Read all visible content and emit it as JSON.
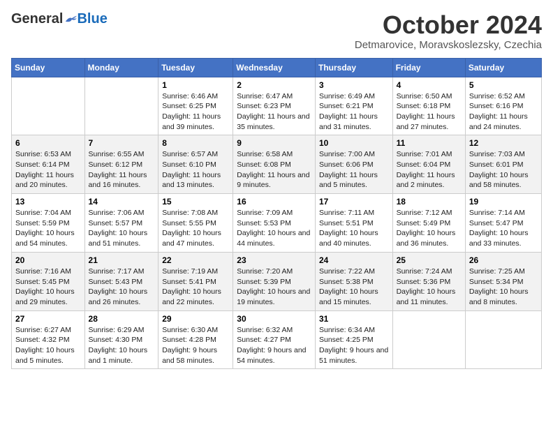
{
  "logo": {
    "general": "General",
    "blue": "Blue"
  },
  "title": "October 2024",
  "location": "Detmarovice, Moravskoslezsky, Czechia",
  "headers": [
    "Sunday",
    "Monday",
    "Tuesday",
    "Wednesday",
    "Thursday",
    "Friday",
    "Saturday"
  ],
  "weeks": [
    [
      {
        "day": "",
        "sunrise": "",
        "sunset": "",
        "daylight": ""
      },
      {
        "day": "",
        "sunrise": "",
        "sunset": "",
        "daylight": ""
      },
      {
        "day": "1",
        "sunrise": "Sunrise: 6:46 AM",
        "sunset": "Sunset: 6:25 PM",
        "daylight": "Daylight: 11 hours and 39 minutes."
      },
      {
        "day": "2",
        "sunrise": "Sunrise: 6:47 AM",
        "sunset": "Sunset: 6:23 PM",
        "daylight": "Daylight: 11 hours and 35 minutes."
      },
      {
        "day": "3",
        "sunrise": "Sunrise: 6:49 AM",
        "sunset": "Sunset: 6:21 PM",
        "daylight": "Daylight: 11 hours and 31 minutes."
      },
      {
        "day": "4",
        "sunrise": "Sunrise: 6:50 AM",
        "sunset": "Sunset: 6:18 PM",
        "daylight": "Daylight: 11 hours and 27 minutes."
      },
      {
        "day": "5",
        "sunrise": "Sunrise: 6:52 AM",
        "sunset": "Sunset: 6:16 PM",
        "daylight": "Daylight: 11 hours and 24 minutes."
      }
    ],
    [
      {
        "day": "6",
        "sunrise": "Sunrise: 6:53 AM",
        "sunset": "Sunset: 6:14 PM",
        "daylight": "Daylight: 11 hours and 20 minutes."
      },
      {
        "day": "7",
        "sunrise": "Sunrise: 6:55 AM",
        "sunset": "Sunset: 6:12 PM",
        "daylight": "Daylight: 11 hours and 16 minutes."
      },
      {
        "day": "8",
        "sunrise": "Sunrise: 6:57 AM",
        "sunset": "Sunset: 6:10 PM",
        "daylight": "Daylight: 11 hours and 13 minutes."
      },
      {
        "day": "9",
        "sunrise": "Sunrise: 6:58 AM",
        "sunset": "Sunset: 6:08 PM",
        "daylight": "Daylight: 11 hours and 9 minutes."
      },
      {
        "day": "10",
        "sunrise": "Sunrise: 7:00 AM",
        "sunset": "Sunset: 6:06 PM",
        "daylight": "Daylight: 11 hours and 5 minutes."
      },
      {
        "day": "11",
        "sunrise": "Sunrise: 7:01 AM",
        "sunset": "Sunset: 6:04 PM",
        "daylight": "Daylight: 11 hours and 2 minutes."
      },
      {
        "day": "12",
        "sunrise": "Sunrise: 7:03 AM",
        "sunset": "Sunset: 6:01 PM",
        "daylight": "Daylight: 10 hours and 58 minutes."
      }
    ],
    [
      {
        "day": "13",
        "sunrise": "Sunrise: 7:04 AM",
        "sunset": "Sunset: 5:59 PM",
        "daylight": "Daylight: 10 hours and 54 minutes."
      },
      {
        "day": "14",
        "sunrise": "Sunrise: 7:06 AM",
        "sunset": "Sunset: 5:57 PM",
        "daylight": "Daylight: 10 hours and 51 minutes."
      },
      {
        "day": "15",
        "sunrise": "Sunrise: 7:08 AM",
        "sunset": "Sunset: 5:55 PM",
        "daylight": "Daylight: 10 hours and 47 minutes."
      },
      {
        "day": "16",
        "sunrise": "Sunrise: 7:09 AM",
        "sunset": "Sunset: 5:53 PM",
        "daylight": "Daylight: 10 hours and 44 minutes."
      },
      {
        "day": "17",
        "sunrise": "Sunrise: 7:11 AM",
        "sunset": "Sunset: 5:51 PM",
        "daylight": "Daylight: 10 hours and 40 minutes."
      },
      {
        "day": "18",
        "sunrise": "Sunrise: 7:12 AM",
        "sunset": "Sunset: 5:49 PM",
        "daylight": "Daylight: 10 hours and 36 minutes."
      },
      {
        "day": "19",
        "sunrise": "Sunrise: 7:14 AM",
        "sunset": "Sunset: 5:47 PM",
        "daylight": "Daylight: 10 hours and 33 minutes."
      }
    ],
    [
      {
        "day": "20",
        "sunrise": "Sunrise: 7:16 AM",
        "sunset": "Sunset: 5:45 PM",
        "daylight": "Daylight: 10 hours and 29 minutes."
      },
      {
        "day": "21",
        "sunrise": "Sunrise: 7:17 AM",
        "sunset": "Sunset: 5:43 PM",
        "daylight": "Daylight: 10 hours and 26 minutes."
      },
      {
        "day": "22",
        "sunrise": "Sunrise: 7:19 AM",
        "sunset": "Sunset: 5:41 PM",
        "daylight": "Daylight: 10 hours and 22 minutes."
      },
      {
        "day": "23",
        "sunrise": "Sunrise: 7:20 AM",
        "sunset": "Sunset: 5:39 PM",
        "daylight": "Daylight: 10 hours and 19 minutes."
      },
      {
        "day": "24",
        "sunrise": "Sunrise: 7:22 AM",
        "sunset": "Sunset: 5:38 PM",
        "daylight": "Daylight: 10 hours and 15 minutes."
      },
      {
        "day": "25",
        "sunrise": "Sunrise: 7:24 AM",
        "sunset": "Sunset: 5:36 PM",
        "daylight": "Daylight: 10 hours and 11 minutes."
      },
      {
        "day": "26",
        "sunrise": "Sunrise: 7:25 AM",
        "sunset": "Sunset: 5:34 PM",
        "daylight": "Daylight: 10 hours and 8 minutes."
      }
    ],
    [
      {
        "day": "27",
        "sunrise": "Sunrise: 6:27 AM",
        "sunset": "Sunset: 4:32 PM",
        "daylight": "Daylight: 10 hours and 5 minutes."
      },
      {
        "day": "28",
        "sunrise": "Sunrise: 6:29 AM",
        "sunset": "Sunset: 4:30 PM",
        "daylight": "Daylight: 10 hours and 1 minute."
      },
      {
        "day": "29",
        "sunrise": "Sunrise: 6:30 AM",
        "sunset": "Sunset: 4:28 PM",
        "daylight": "Daylight: 9 hours and 58 minutes."
      },
      {
        "day": "30",
        "sunrise": "Sunrise: 6:32 AM",
        "sunset": "Sunset: 4:27 PM",
        "daylight": "Daylight: 9 hours and 54 minutes."
      },
      {
        "day": "31",
        "sunrise": "Sunrise: 6:34 AM",
        "sunset": "Sunset: 4:25 PM",
        "daylight": "Daylight: 9 hours and 51 minutes."
      },
      {
        "day": "",
        "sunrise": "",
        "sunset": "",
        "daylight": ""
      },
      {
        "day": "",
        "sunrise": "",
        "sunset": "",
        "daylight": ""
      }
    ]
  ]
}
